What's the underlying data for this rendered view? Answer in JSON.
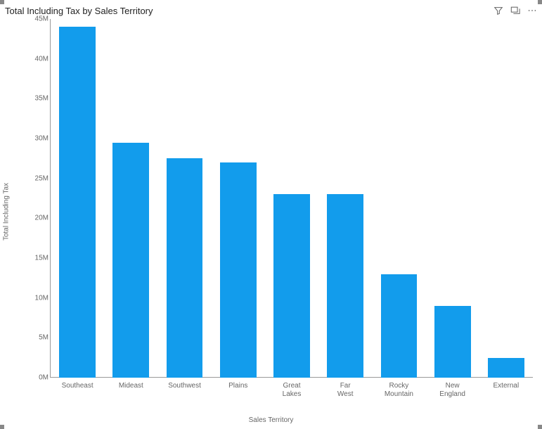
{
  "chart_data": {
    "type": "bar",
    "title": "Total Including Tax by Sales Territory",
    "xlabel": "Sales Territory",
    "ylabel": "Total Including Tax",
    "ylim": [
      0,
      45000000
    ],
    "yticks": [
      {
        "value": 0,
        "label": "0M"
      },
      {
        "value": 5000000,
        "label": "5M"
      },
      {
        "value": 10000000,
        "label": "10M"
      },
      {
        "value": 15000000,
        "label": "15M"
      },
      {
        "value": 20000000,
        "label": "20M"
      },
      {
        "value": 25000000,
        "label": "25M"
      },
      {
        "value": 30000000,
        "label": "30M"
      },
      {
        "value": 35000000,
        "label": "35M"
      },
      {
        "value": 40000000,
        "label": "40M"
      },
      {
        "value": 45000000,
        "label": "45M"
      }
    ],
    "categories": [
      "Southeast",
      "Mideast",
      "Southwest",
      "Plains",
      "Great Lakes",
      "Far West",
      "Rocky\nMountain",
      "New England",
      "External"
    ],
    "values": [
      44000000,
      29500000,
      27500000,
      27000000,
      23000000,
      23000000,
      13000000,
      9000000,
      2500000
    ],
    "bar_color": "#129CEC"
  },
  "toolbar": {
    "filter": "Filters",
    "focus": "Focus mode",
    "more": "More options"
  }
}
